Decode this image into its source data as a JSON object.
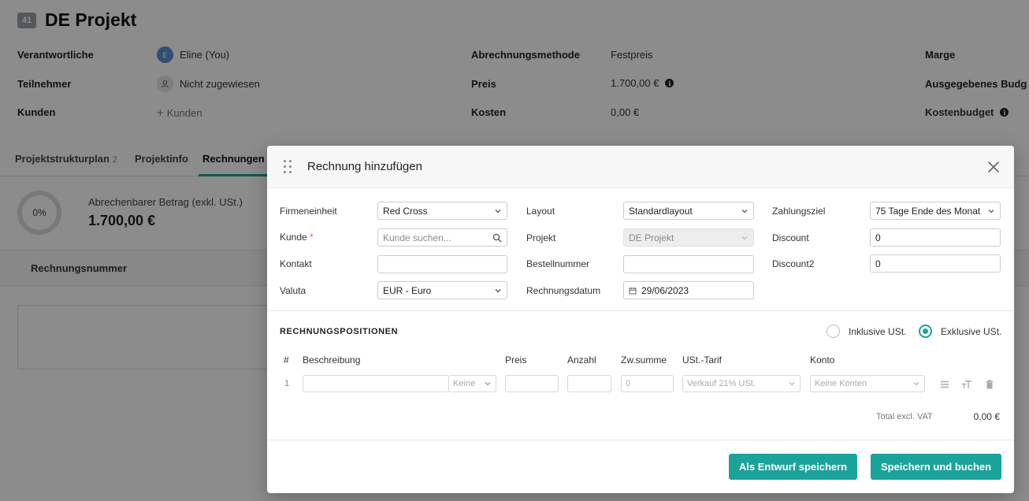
{
  "project": {
    "id_badge": "41",
    "title": "DE Projekt"
  },
  "info": {
    "owner_label": "Verantwortliche",
    "owner_initial": "E",
    "owner_value": "Eline (You)",
    "participants_label": "Teilnehmer",
    "participants_value": "Nicht zugewiesen",
    "customers_label": "Kunden",
    "customers_value": "Kunden",
    "billing_method_label": "Abrechnungsmethode",
    "billing_method_value": "Festpreis",
    "price_label": "Preis",
    "price_value": "1.700,00 €",
    "costs_label": "Kosten",
    "costs_value": "0,00 €",
    "margin_label": "Marge",
    "spent_budget_label": "Ausgegebenes Budg",
    "cost_budget_label": "Kostenbudget"
  },
  "tabs": [
    {
      "label": "Projektstrukturplan",
      "count": "2"
    },
    {
      "label": "Projektinfo",
      "count": ""
    },
    {
      "label": "Rechnungen",
      "count": ""
    }
  ],
  "billing": {
    "progress": "0%",
    "amount_label": "Abrechenbarer Betrag (exkl. USt.)",
    "amount_value": "1.700,00 €"
  },
  "invoice_table": {
    "column": "Rechnungsnummer"
  },
  "modal": {
    "title": "Rechnung hinzufügen",
    "fields": {
      "company_label": "Firmeneinheit",
      "company_value": "Red Cross",
      "customer_label": "Kunde",
      "customer_required": "*",
      "customer_placeholder": "Kunde suchen...",
      "contact_label": "Kontakt",
      "contact_value": "",
      "currency_label": "Valuta",
      "currency_value": "EUR - Euro",
      "layout_label": "Layout",
      "layout_value": "Standardlayout",
      "project_label": "Projekt",
      "project_value": "DE Projekt",
      "order_number_label": "Bestellnummer",
      "order_number_value": "",
      "invoice_date_label": "Rechnungsdatum",
      "invoice_date_value": "29/06/2023",
      "payment_term_label": "Zahlungsziel",
      "payment_term_value": "75 Tage Ende des Monat",
      "discount_label": "Discount",
      "discount_value": "0",
      "discount2_label": "Discount2",
      "discount2_value": "0"
    },
    "positions": {
      "section_title": "RECHNUNGSPOSITIONEN",
      "vat_inclusive_label": "Inklusive USt.",
      "vat_exclusive_label": "Exklusive USt.",
      "vat_mode": "exclusive",
      "columns": {
        "num": "#",
        "description": "Beschreibung",
        "price": "Preis",
        "quantity": "Anzahl",
        "subtotal": "Zw.summe",
        "vat_rate": "USt.-Tarif",
        "account": "Konto"
      },
      "rows": [
        {
          "num": "1",
          "description": "",
          "unit_placeholder": "Keine",
          "price": "",
          "quantity": "",
          "subtotal": "0",
          "vat_rate": "Verkauf 21% USt.",
          "account": "Keine Konten"
        }
      ],
      "total_label": "Total excl. VAT",
      "total_value": "0,00 €"
    },
    "buttons": {
      "save_draft": "Als Entwurf speichern",
      "save_book": "Speichern und buchen"
    }
  },
  "colors": {
    "accent": "#1aa39b",
    "required": "#e06a3b",
    "avatar": "#5b8fd1"
  }
}
